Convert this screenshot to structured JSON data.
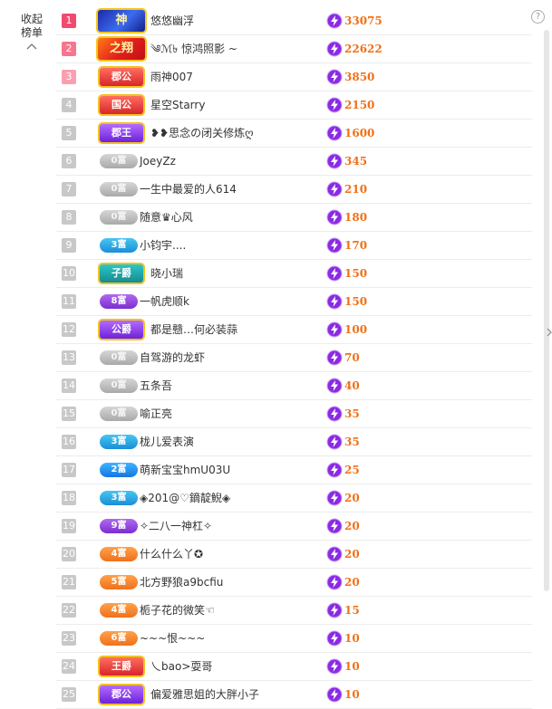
{
  "sidebar": {
    "collapse_label_1": "收起",
    "collapse_label_2": "榜单",
    "help_label": "?"
  },
  "colors": {
    "score": "#f07018",
    "rank_top": "#f24a6e",
    "rank_default": "#c8c8c8"
  },
  "rows": [
    {
      "rank": "1",
      "badge": "crown1",
      "badge_text": "神",
      "name": "悠悠幽浮",
      "score": "33075"
    },
    {
      "rank": "2",
      "badge": "crown2",
      "badge_text": "之翔",
      "name": "༄ℳ৳ 惊鸿照影 ~",
      "score": "22622"
    },
    {
      "rank": "3",
      "badge": "shield-red",
      "badge_text": "郡公",
      "name": "雨神007",
      "score": "3850"
    },
    {
      "rank": "4",
      "badge": "shield-red",
      "badge_text": "国公",
      "name": "星空Starry",
      "score": "2150"
    },
    {
      "rank": "5",
      "badge": "shield-purple",
      "badge_text": "郡王",
      "name": "❥❥思念の闭关修炼ღ",
      "score": "1600"
    },
    {
      "rank": "6",
      "badge": "gray",
      "badge_text": "0富",
      "name": "JoeyZz",
      "score": "345"
    },
    {
      "rank": "7",
      "badge": "gray",
      "badge_text": "0富",
      "name": "一生中最爱的人614",
      "score": "210"
    },
    {
      "rank": "8",
      "badge": "gray",
      "badge_text": "0富",
      "name": "随意♛心风",
      "score": "180"
    },
    {
      "rank": "9",
      "badge": "blue",
      "badge_text": "3富",
      "name": "小钧宇....",
      "score": "170"
    },
    {
      "rank": "10",
      "badge": "shield-teal",
      "badge_text": "子爵",
      "name": "晓小瑞",
      "score": "150"
    },
    {
      "rank": "11",
      "badge": "purple",
      "badge_text": "8富",
      "name": "一帆虎顺k",
      "score": "150"
    },
    {
      "rank": "12",
      "badge": "shield-purple",
      "badge_text": "公爵",
      "name": "都是戆…何必装蒜",
      "score": "100"
    },
    {
      "rank": "13",
      "badge": "gray",
      "badge_text": "0富",
      "name": "自驾游的龙虾",
      "score": "70"
    },
    {
      "rank": "14",
      "badge": "gray",
      "badge_text": "0富",
      "name": "五条吾",
      "score": "40"
    },
    {
      "rank": "15",
      "badge": "gray",
      "badge_text": "0富",
      "name": "喻正亮",
      "score": "35"
    },
    {
      "rank": "16",
      "badge": "blue",
      "badge_text": "3富",
      "name": "栊儿爱表演",
      "score": "35"
    },
    {
      "rank": "17",
      "badge": "blue2",
      "badge_text": "2富",
      "name": "萌新宝宝hmU03U",
      "score": "25"
    },
    {
      "rank": "18",
      "badge": "blue",
      "badge_text": "3富",
      "name": "◈201@♡鏑靛鯢◈",
      "score": "20"
    },
    {
      "rank": "19",
      "badge": "purple",
      "badge_text": "9富",
      "name": "✧二八一神杠✧",
      "score": "20"
    },
    {
      "rank": "20",
      "badge": "orange",
      "badge_text": "4富",
      "name": "什么什么丫✪",
      "score": "20"
    },
    {
      "rank": "21",
      "badge": "orange",
      "badge_text": "5富",
      "name": "北方野狼a9bcfiu",
      "score": "20"
    },
    {
      "rank": "22",
      "badge": "orange",
      "badge_text": "4富",
      "name": "栀子花的微笑☜",
      "score": "15"
    },
    {
      "rank": "23",
      "badge": "orange",
      "badge_text": "6富",
      "name": "~~~恨~~~",
      "score": "10"
    },
    {
      "rank": "24",
      "badge": "shield-red",
      "badge_text": "王爵",
      "name": "乀bao>耍哥",
      "score": "10"
    },
    {
      "rank": "25",
      "badge": "shield-purple",
      "badge_text": "郡公",
      "name": "偏爱雅思姐的大胖小子",
      "score": "10"
    }
  ]
}
